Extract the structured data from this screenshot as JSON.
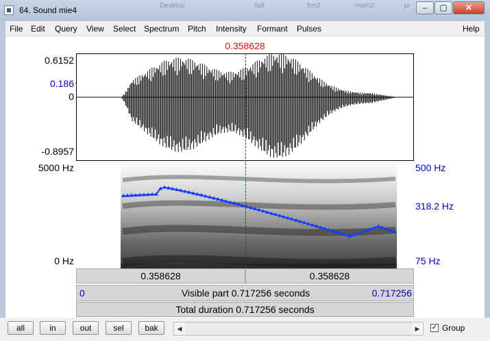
{
  "window": {
    "title": "64. Sound mie4",
    "background_items": [
      "Desktop",
      "fa8",
      "fon2",
      "mam2",
      "pi"
    ],
    "controls": {
      "minimize": "–",
      "maximize": "▢",
      "close": "✕"
    }
  },
  "menu": {
    "items": [
      "File",
      "Edit",
      "Query",
      "View",
      "Select",
      "Spectrum",
      "Pitch",
      "Intensity",
      "Formant",
      "Pulses"
    ],
    "help": "Help"
  },
  "cursor": {
    "time_label": "0.358628"
  },
  "waveform": {
    "y_max": "0.6152",
    "y_cursor": "0.186",
    "y_zero": "0",
    "y_min": "-0.8957"
  },
  "spectrogram": {
    "freq_max": "5000 Hz",
    "freq_min": "0 Hz",
    "pitch_max": "500 Hz",
    "pitch_cursor": "318.2 Hz",
    "pitch_min": "75 Hz"
  },
  "time_rows": {
    "left_segment": "0.358628",
    "right_segment": "0.358628",
    "visible_start": "0",
    "visible_label": "Visible part 0.717256 seconds",
    "visible_end": "0.717256",
    "total_label": "Total duration 0.717256 seconds"
  },
  "bottom": {
    "buttons": [
      "all",
      "in",
      "out",
      "sel",
      "bak"
    ],
    "group_label": "Group",
    "group_checked": true,
    "scroll_left": "◀",
    "scroll_right": "▶"
  },
  "colors": {
    "cursor": "#cc0000",
    "pitch": "#1a3cff",
    "axis_blue": "#0000c8"
  }
}
